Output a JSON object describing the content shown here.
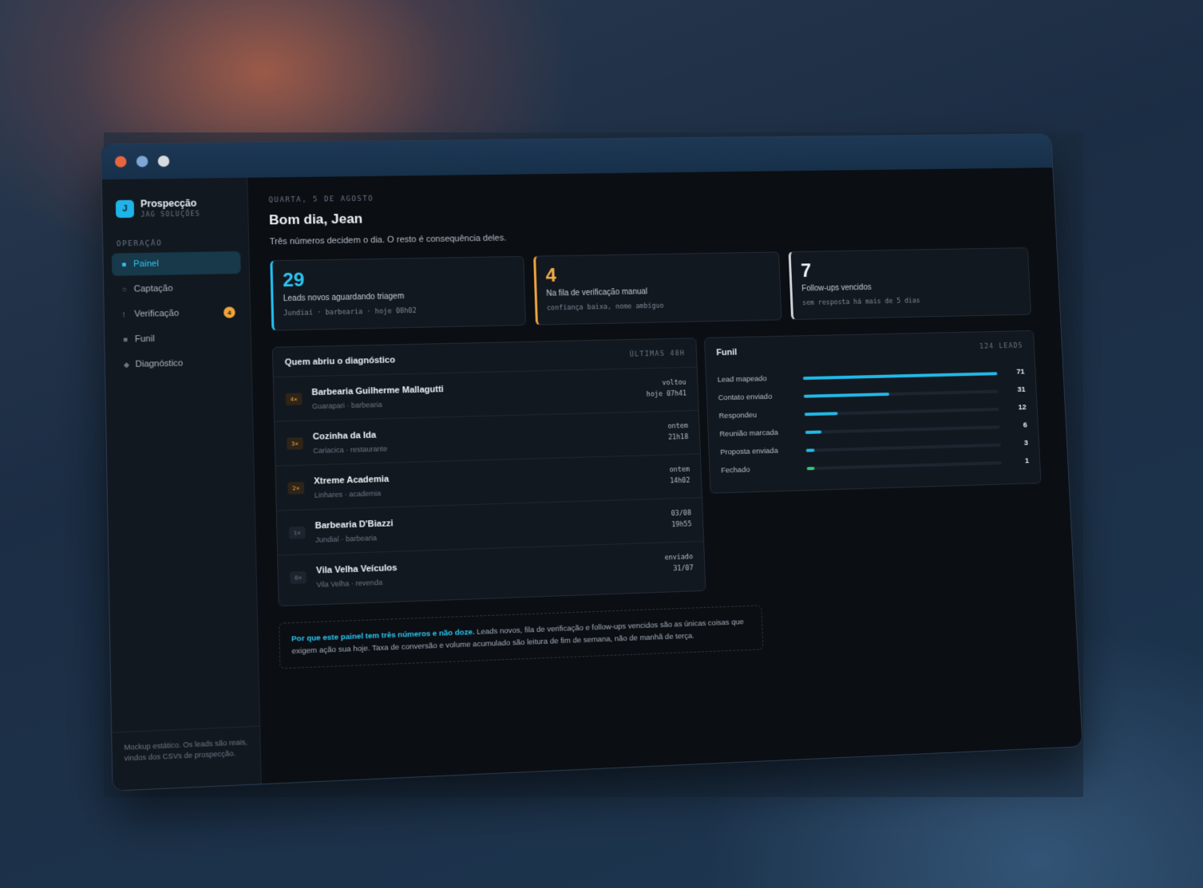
{
  "window": {
    "dots": [
      "close",
      "minimize",
      "maximize"
    ]
  },
  "brand": {
    "logo_letter": "J",
    "name": "Prospecção",
    "subtitle": "JAG SOLUÇÕES"
  },
  "sidebar": {
    "section_label": "OPERAÇÃO",
    "items": [
      {
        "label": "Painel",
        "icon": "square-icon",
        "glyph": "■",
        "active": true
      },
      {
        "label": "Captação",
        "icon": "search-icon",
        "glyph": "○"
      },
      {
        "label": "Verificação",
        "icon": "alert-icon",
        "glyph": "!",
        "badge": "4"
      },
      {
        "label": "Funil",
        "icon": "square-icon",
        "glyph": "■"
      },
      {
        "label": "Diagnóstico",
        "icon": "diamond-icon",
        "glyph": "◆"
      }
    ],
    "footer": "Mockup estático. Os leads são reais, vindos dos CSVs de prospecção."
  },
  "header": {
    "date": "QUARTA, 5 DE AGOSTO",
    "greeting": "Bom dia, Jean",
    "subtitle": "Três números decidem o dia. O resto é consequência deles."
  },
  "stats": [
    {
      "value": "29",
      "label": "Leads novos aguardando triagem",
      "meta": "Jundiaí · barbearia · hoje 08h02",
      "color": "#2cc6f2"
    },
    {
      "value": "4",
      "label": "Na fila de verificação manual",
      "meta": "confiança baixa, nome ambíguo",
      "color": "#f3ae4a"
    },
    {
      "value": "7",
      "label": "Follow-ups vencidos",
      "meta": "sem resposta há mais de 5 dias",
      "color": "#eef3f8"
    }
  ],
  "openers": {
    "title": "Quem abriu o diagnóstico",
    "tag": "ÚLTIMAS 48H",
    "rows": [
      {
        "badge": "4×",
        "name": "Barbearia Guilherme Mallagutti",
        "sub": "Guarapari · barbearia",
        "when1": "voltou",
        "when2": "hoje 07h41"
      },
      {
        "badge": "3×",
        "name": "Cozinha da Ida",
        "sub": "Cariacica · restaurante",
        "when1": "ontem",
        "when2": "21h18"
      },
      {
        "badge": "2×",
        "name": "Xtreme Academia",
        "sub": "Linhares · academia",
        "when1": "ontem",
        "when2": "14h02"
      },
      {
        "badge": "1×",
        "name": "Barbearia D'Biazzi",
        "sub": "Jundiaí · barbearia",
        "when1": "03/08",
        "when2": "19h55"
      },
      {
        "badge": "0×",
        "name": "Vila Velha Veículos",
        "sub": "Vila Velha · revenda",
        "when1": "enviado",
        "when2": "31/07"
      }
    ]
  },
  "funnel": {
    "title": "Funil",
    "tag": "124 LEADS",
    "max": 71,
    "stages": [
      {
        "label": "Lead mapeado",
        "count": "71",
        "value": 71
      },
      {
        "label": "Contato enviado",
        "count": "31",
        "value": 31
      },
      {
        "label": "Respondeu",
        "count": "12",
        "value": 12
      },
      {
        "label": "Reunião marcada",
        "count": "6",
        "value": 6
      },
      {
        "label": "Proposta enviada",
        "count": "3",
        "value": 3
      },
      {
        "label": "Fechado",
        "count": "1",
        "value": 1
      }
    ]
  },
  "note": {
    "strong": "Por que este painel tem três números e não doze.",
    "text": " Leads novos, fila de verificação e follow-ups vencidos são as únicas coisas que exigem ação sua hoje. Taxa de conversão e volume acumulado são leitura de fim de semana, não de manhã de terça."
  }
}
